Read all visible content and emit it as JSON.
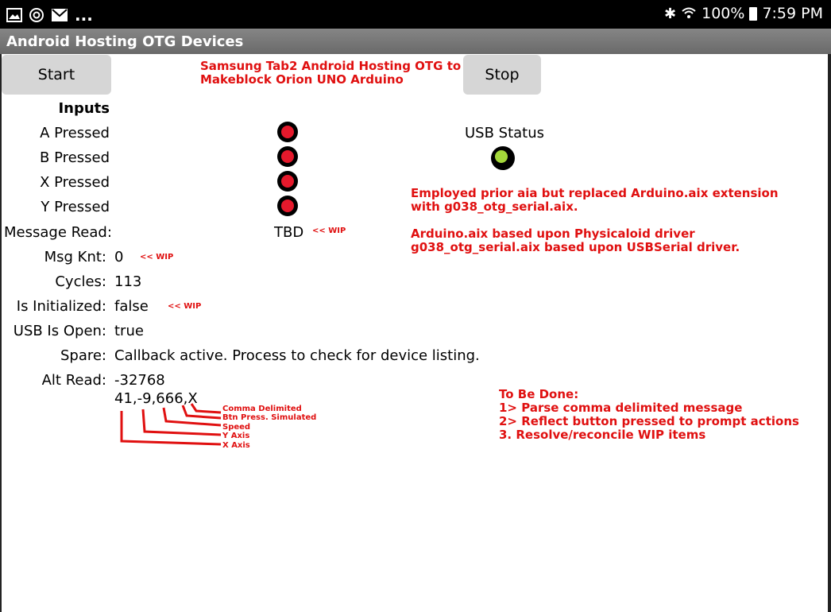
{
  "status_bar": {
    "left_icons": [
      "gallery-icon",
      "sync-icon",
      "mail-icon"
    ],
    "more": "...",
    "right_icons": [
      "bluetooth-icon",
      "wifi-icon"
    ],
    "battery": "100%",
    "time": "7:59 PM"
  },
  "app": {
    "title": "Android Hosting OTG Devices"
  },
  "buttons": {
    "start": "Start",
    "stop": "Stop"
  },
  "header_note": {
    "line1": "Samsung Tab2 Android Hosting OTG to",
    "line2": "Makeblock Orion UNO Arduino"
  },
  "inputs_heading": "Inputs",
  "rows": {
    "a": "A Pressed",
    "b": "B Pressed",
    "x": "X Pressed",
    "y": "Y Pressed",
    "message_read": {
      "label": "Message Read:",
      "value": "TBD"
    },
    "msg_knt": {
      "label": "Msg Knt:",
      "value": "0"
    },
    "cycles": {
      "label": "Cycles:",
      "value": "113"
    },
    "is_initialized": {
      "label": "Is Initialized:",
      "value": "false"
    },
    "usb_is_open": {
      "label": "USB Is Open:",
      "value": "true"
    },
    "spare": {
      "label": "Spare:",
      "value": "Callback active.  Process to check for device listing."
    },
    "alt_read": {
      "label": "Alt Read:",
      "value": "-32768",
      "message": "41,-9,666,X"
    }
  },
  "wip_tag": "<< WIP",
  "usb_status": {
    "label": "USB Status",
    "led_color": "#a4d83a"
  },
  "led_color_off": "#e5192c",
  "notes": {
    "employed_1": "Employed prior aia but replaced Arduino.aix extension",
    "employed_2": "with g038_otg_serial.aix.",
    "based_1": "Arduino.aix based upon Physicaloid driver",
    "based_2": "g038_otg_serial.aix based upon USBSerial  driver."
  },
  "callouts": {
    "comma": "Comma Delimited",
    "btn": "Btn Press.  Simulated",
    "speed": "Speed",
    "y_axis": "Y Axis",
    "x_axis": "X Axis"
  },
  "todo": {
    "title": "To Be Done:",
    "items": [
      "1> Parse comma delimited message",
      "2> Reflect button pressed to prompt actions",
      "3. Resolve/reconcile WIP items"
    ]
  }
}
